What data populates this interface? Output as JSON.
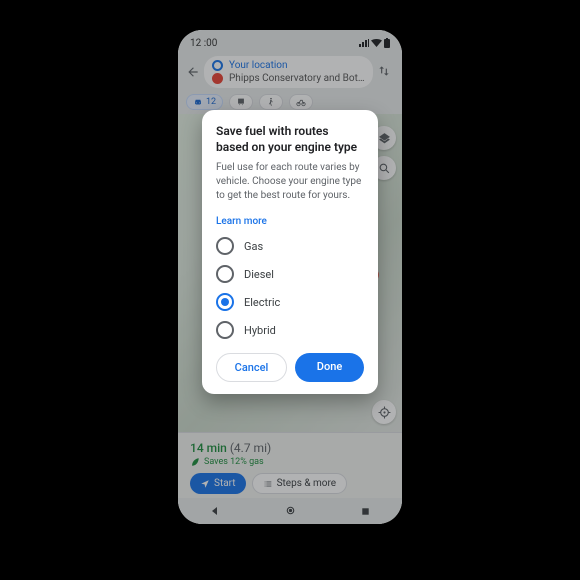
{
  "statusbar": {
    "time": "12 :00"
  },
  "search": {
    "origin": "Your location",
    "destination": "Phipps Conservatory and Bot…"
  },
  "modes": {
    "car": "12"
  },
  "sheet": {
    "minutes": "14 min",
    "distance": "(4.7 mi)",
    "eco": "Saves 12% gas",
    "start": "Start",
    "steps": "Steps & more"
  },
  "dialog": {
    "title": "Save fuel with routes based on your engine type",
    "body": "Fuel use for each route varies by vehicle. Choose your engine type to get the best route for yours.",
    "learn": "Learn more",
    "options": [
      "Gas",
      "Diesel",
      "Electric",
      "Hybrid"
    ],
    "selected": "Electric",
    "cancel": "Cancel",
    "done": "Done"
  }
}
